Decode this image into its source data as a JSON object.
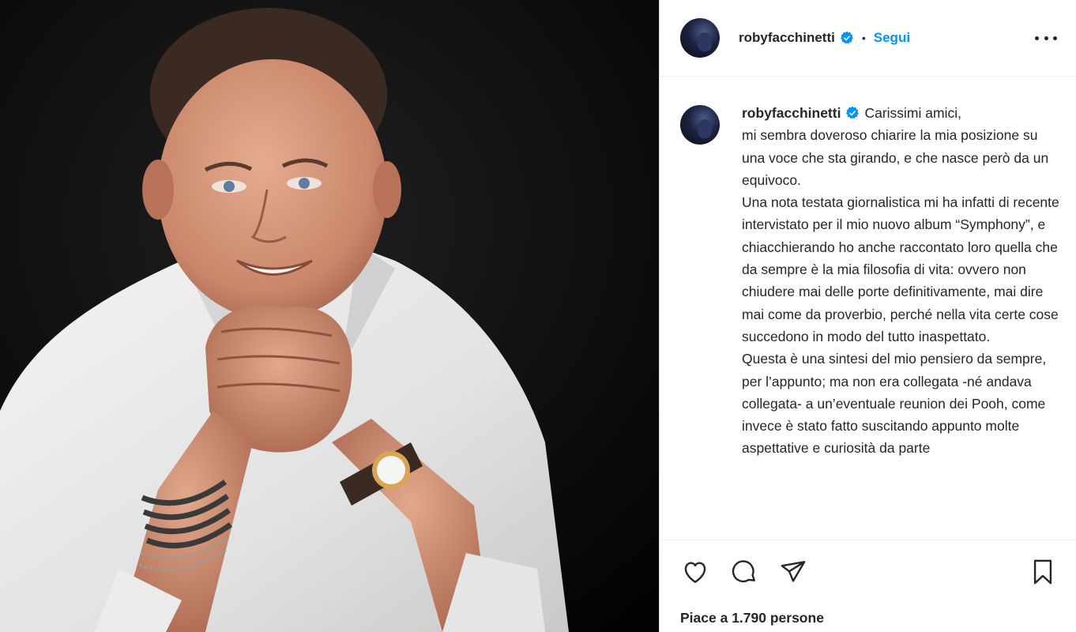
{
  "post": {
    "photo_alt": "roby facchinetti portrait"
  },
  "header": {
    "username": "robyfacchinetti",
    "separator": "•",
    "follow_label": "Segui"
  },
  "caption": {
    "username": "robyfacchinetti",
    "text": "Carissimi amici,\nmi sembra doveroso chiarire la mia posizione su una voce che sta girando, e che nasce però da un equivoco.\nUna nota testata giornalistica mi ha infatti di recente intervistato per il mio nuovo album “Symphony”, e chiacchierando ho anche raccontato loro quella che da sempre è la mia filosofia di vita: ovvero non chiudere mai delle porte definitivamente, mai dire mai come da proverbio, perché nella vita certe cose succedono in modo del tutto inaspettato.\nQuesta è una sintesi del mio pensiero da sempre, per l’appunto; ma non era collegata -né andava collegata- a un’eventuale reunion dei Pooh, come invece è stato fatto suscitando appunto molte aspettative e curiosità da parte"
  },
  "actions": {
    "icons": [
      "heart-icon",
      "comment-icon",
      "share-icon",
      "bookmark-icon"
    ],
    "likes_text": "Piace a 1.790 persone"
  },
  "colors": {
    "accent": "#0095f6",
    "verified": "#0095f6",
    "text": "#262626",
    "border": "#dbdbdb"
  }
}
